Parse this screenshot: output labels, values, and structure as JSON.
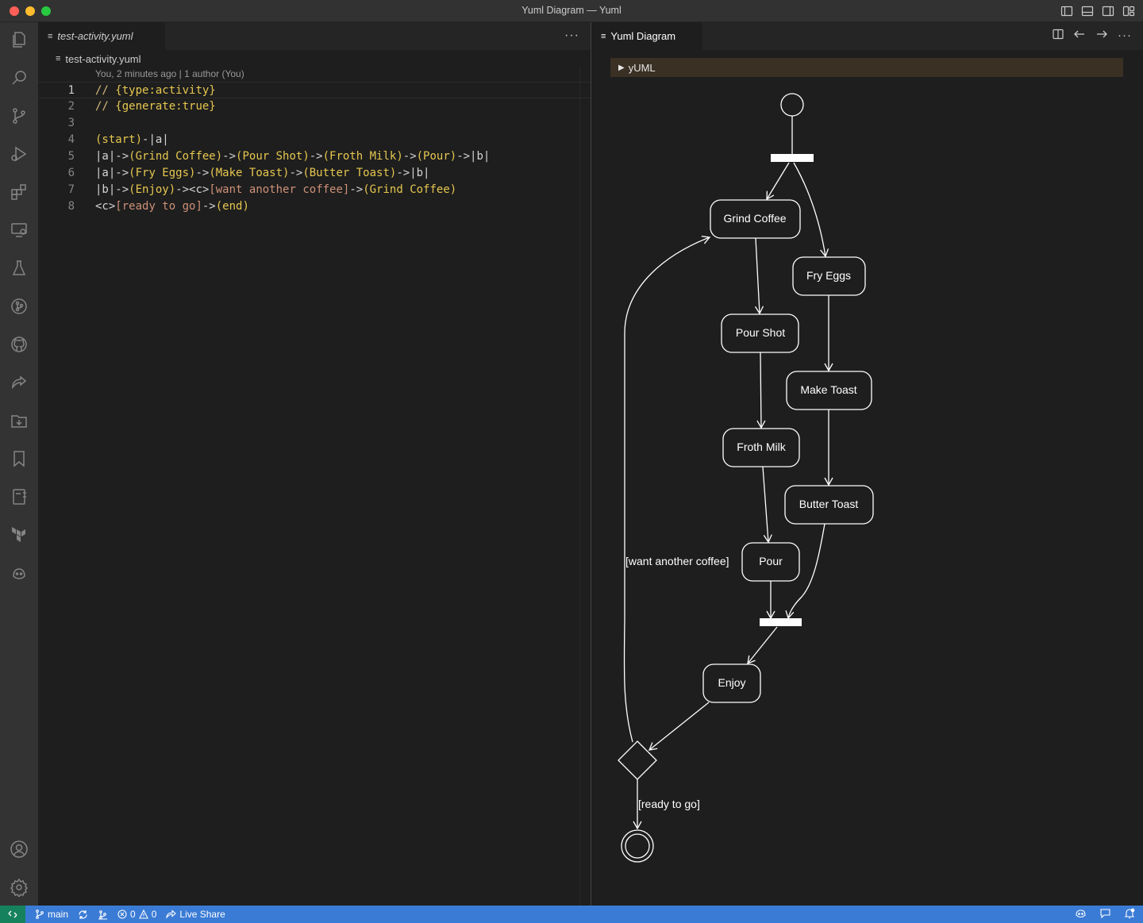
{
  "window": {
    "title": "Yuml Diagram — Yuml"
  },
  "activity_bar": {
    "icons": [
      "files-icon",
      "search-icon",
      "source-control-icon",
      "run-debug-icon",
      "extensions-icon",
      "remote-explorer-icon",
      "testing-icon",
      "git-graph-icon",
      "github-icon",
      "live-share-icon",
      "download-icon",
      "bookmarks-icon",
      "notebook-icon",
      "terraform-icon",
      "copilot-icon",
      "account-icon",
      "settings-gear-icon"
    ]
  },
  "editor": {
    "tab_label": "test-activity.yuml",
    "breadcrumb": "test-activity.yuml",
    "codelens": "You, 2 minutes ago | 1 author (You)",
    "more": "···",
    "lines": [
      {
        "num": "1",
        "segments": [
          {
            "t": "// ",
            "c": "c-comment"
          },
          {
            "t": "{type:activity}",
            "c": "c-gold"
          }
        ]
      },
      {
        "num": "2",
        "segments": [
          {
            "t": "// ",
            "c": "c-comment"
          },
          {
            "t": "{generate:true}",
            "c": "c-gold"
          }
        ]
      },
      {
        "num": "3",
        "segments": []
      },
      {
        "num": "4",
        "segments": [
          {
            "t": "(start)",
            "c": "c-gold"
          },
          {
            "t": "-|a|",
            "c": "c-white"
          }
        ]
      },
      {
        "num": "5",
        "segments": [
          {
            "t": "|a|->",
            "c": "c-white"
          },
          {
            "t": "(Grind Coffee)",
            "c": "c-gold"
          },
          {
            "t": "->",
            "c": "c-white"
          },
          {
            "t": "(Pour Shot)",
            "c": "c-gold"
          },
          {
            "t": "->",
            "c": "c-white"
          },
          {
            "t": "(Froth Milk)",
            "c": "c-gold"
          },
          {
            "t": "->",
            "c": "c-white"
          },
          {
            "t": "(Pour)",
            "c": "c-gold"
          },
          {
            "t": "->|b|",
            "c": "c-white"
          }
        ]
      },
      {
        "num": "6",
        "segments": [
          {
            "t": "|a|->",
            "c": "c-white"
          },
          {
            "t": "(Fry Eggs)",
            "c": "c-gold"
          },
          {
            "t": "->",
            "c": "c-white"
          },
          {
            "t": "(Make Toast)",
            "c": "c-gold"
          },
          {
            "t": "->",
            "c": "c-white"
          },
          {
            "t": "(Butter Toast)",
            "c": "c-gold"
          },
          {
            "t": "->|b|",
            "c": "c-white"
          }
        ]
      },
      {
        "num": "7",
        "segments": [
          {
            "t": "|b|->",
            "c": "c-white"
          },
          {
            "t": "(Enjoy)",
            "c": "c-gold"
          },
          {
            "t": "-><c>",
            "c": "c-white"
          },
          {
            "t": "[want another coffee]",
            "c": "c-orange"
          },
          {
            "t": "->",
            "c": "c-white"
          },
          {
            "t": "(Grind Coffee)",
            "c": "c-gold"
          }
        ]
      },
      {
        "num": "8",
        "segments": [
          {
            "t": "<c>",
            "c": "c-white"
          },
          {
            "t": "[ready to go]",
            "c": "c-orange"
          },
          {
            "t": "->",
            "c": "c-white"
          },
          {
            "t": "(end)",
            "c": "c-gold"
          }
        ]
      }
    ]
  },
  "preview": {
    "tab_label": "Yuml Diagram",
    "actions": [
      "split-editor-icon",
      "back-arrow-icon",
      "forward-arrow-icon",
      "more-icon"
    ],
    "section_label": "yUML",
    "nodes": {
      "grind_coffee": "Grind Coffee",
      "fry_eggs": "Fry Eggs",
      "pour_shot": "Pour Shot",
      "make_toast": "Make Toast",
      "froth_milk": "Froth Milk",
      "butter_toast": "Butter Toast",
      "pour": "Pour",
      "enjoy": "Enjoy"
    },
    "guards": {
      "want_another": "[want another coffee]",
      "ready_to_go": "[ready to go]"
    }
  },
  "statusbar": {
    "branch": "main",
    "errors": "0",
    "warnings": "0",
    "live_share": "Live Share"
  },
  "colors": {
    "status_bar": "#3a7bd5",
    "remote_button": "#16825d",
    "keyword_gold": "#e6c74f",
    "guard_orange": "#ce9178"
  }
}
